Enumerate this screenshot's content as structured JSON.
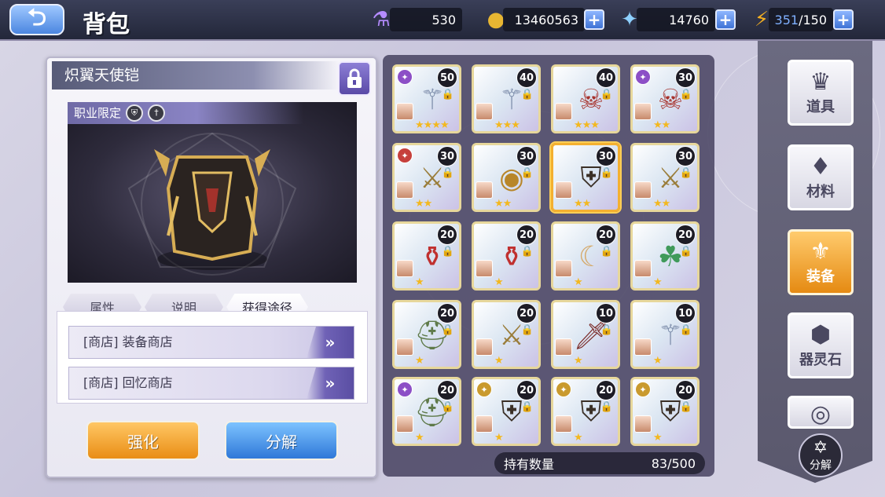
{
  "header": {
    "title": "背包",
    "back_icon": "back-arrow-icon"
  },
  "resources": [
    {
      "name": "potion",
      "icon": "potion-bottle-icon",
      "value": "530",
      "has_plus": false
    },
    {
      "name": "gold",
      "icon": "gold-coin-icon",
      "value": "13460563",
      "has_plus": true
    },
    {
      "name": "crystal",
      "icon": "star-crystal-icon",
      "value": "14760",
      "has_plus": true
    },
    {
      "name": "stamina",
      "icon": "lightning-icon",
      "current": "351",
      "max": "/150",
      "has_plus": true
    }
  ],
  "detail": {
    "item_name": "炽翼天使铠",
    "job_label": "职业限定",
    "tabs": [
      "属性",
      "说明",
      "获得途径"
    ],
    "active_tab": 2,
    "sources": [
      {
        "label": "[商店] 装备商店"
      },
      {
        "label": "[商店] 回忆商店"
      }
    ],
    "enhance_label": "强化",
    "decompose_label": "分解"
  },
  "items": [
    {
      "level": "50",
      "stars": 4,
      "set": "purple",
      "art": "staff"
    },
    {
      "level": "40",
      "stars": 3,
      "set": "",
      "art": "staff"
    },
    {
      "level": "40",
      "stars": 3,
      "set": "",
      "art": "demon-mask"
    },
    {
      "level": "30",
      "stars": 2,
      "set": "purple",
      "art": "demon-mask"
    },
    {
      "level": "30",
      "stars": 2,
      "set": "red",
      "art": "spear"
    },
    {
      "level": "30",
      "stars": 2,
      "set": "",
      "art": "shield"
    },
    {
      "level": "30",
      "stars": 2,
      "set": "",
      "art": "armor",
      "selected": true
    },
    {
      "level": "30",
      "stars": 2,
      "set": "",
      "art": "spear"
    },
    {
      "level": "20",
      "stars": 1,
      "set": "",
      "art": "potion"
    },
    {
      "level": "20",
      "stars": 1,
      "set": "",
      "art": "potion"
    },
    {
      "level": "20",
      "stars": 1,
      "set": "",
      "art": "horn"
    },
    {
      "level": "20",
      "stars": 1,
      "set": "",
      "art": "ring"
    },
    {
      "level": "20",
      "stars": 1,
      "set": "",
      "art": "helmet"
    },
    {
      "level": "20",
      "stars": 1,
      "set": "",
      "art": "spear"
    },
    {
      "level": "10",
      "stars": 1,
      "set": "",
      "art": "sword"
    },
    {
      "level": "10",
      "stars": 1,
      "set": "",
      "art": "staff"
    },
    {
      "level": "20",
      "stars": 1,
      "set": "purple",
      "art": "helmet"
    },
    {
      "level": "20",
      "stars": 1,
      "set": "gold",
      "art": "armor"
    },
    {
      "level": "20",
      "stars": 1,
      "set": "gold",
      "art": "armor"
    },
    {
      "level": "20",
      "stars": 1,
      "set": "gold",
      "art": "armor"
    }
  ],
  "inventory": {
    "count_label": "持有数量",
    "count_value": "83/500"
  },
  "categories": [
    {
      "label": "道具",
      "icon": "item-crown-icon",
      "active": false
    },
    {
      "label": "材料",
      "icon": "material-crystal-icon",
      "active": false
    },
    {
      "label": "装备",
      "icon": "equipment-lily-icon",
      "active": true
    },
    {
      "label": "器灵石",
      "icon": "spirit-stone-icon",
      "active": false
    },
    {
      "label": "",
      "icon": "ring-icon",
      "active": false
    }
  ],
  "bottom_decompose": "分解",
  "colors": {
    "accent_orange": "#e98d15",
    "accent_blue": "#2f78d8",
    "panel_dark": "#464260"
  }
}
